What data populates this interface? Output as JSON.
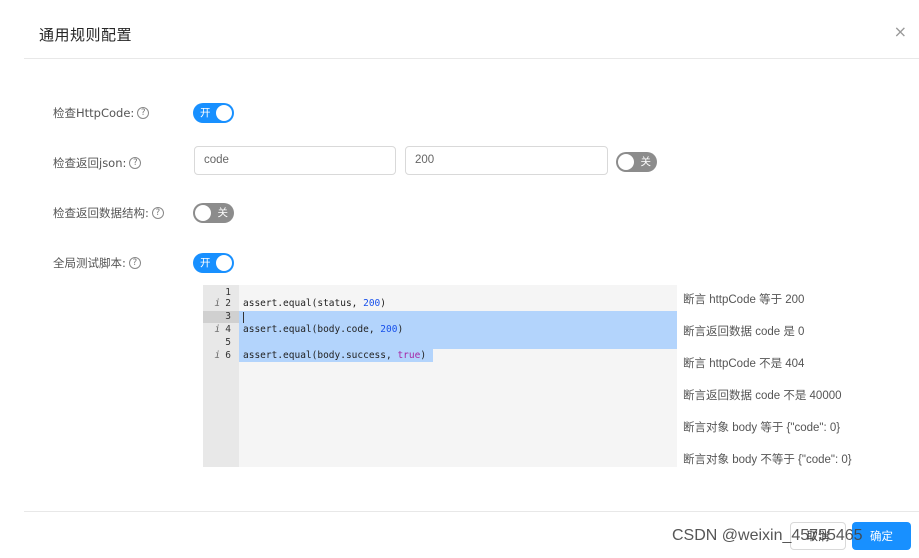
{
  "dialog": {
    "title": "通用规则配置",
    "close_icon": "×"
  },
  "form": {
    "http_code": {
      "label": "检查HttpCode:",
      "help_icon": "?",
      "switch_on": true,
      "switch_text": "开"
    },
    "return_json": {
      "label": "检查返回json:",
      "help_icon": "?",
      "key_value": "code",
      "value_value": "200",
      "switch_on": false,
      "switch_text": "关"
    },
    "data_structure": {
      "label": "检查返回数据结构:",
      "help_icon": "?",
      "switch_on": false,
      "switch_text": "关"
    },
    "global_script": {
      "label": "全局测试脚本:",
      "help_icon": "?",
      "switch_on": true,
      "switch_text": "开"
    }
  },
  "editor": {
    "lines": [
      {
        "number": "1",
        "info": "",
        "code": ""
      },
      {
        "number": "2",
        "info": "i",
        "code_prefix": "assert.equal(status, ",
        "code_num": "200",
        "code_suffix": ")"
      },
      {
        "number": "3",
        "info": "",
        "code": ""
      },
      {
        "number": "4",
        "info": "i",
        "code_prefix": "assert.equal(body.code, ",
        "code_num": "200",
        "code_suffix": ")"
      },
      {
        "number": "5",
        "info": "",
        "code": ""
      },
      {
        "number": "6",
        "info": "i",
        "code_prefix": "assert.equal(body.success, ",
        "code_kw": "true",
        "code_suffix": ")"
      }
    ]
  },
  "suggestions": [
    "断言 httpCode 等于 200",
    "断言返回数据 code 是 0",
    "断言 httpCode 不是 404",
    "断言返回数据 code 不是 40000",
    "断言对象 body 等于 {\"code\": 0}",
    "断言对象 body 不等于 {\"code\": 0}"
  ],
  "footer": {
    "cancel_label": "取消",
    "ok_label": "确定"
  },
  "watermark": "CSDN @weixin_45755465",
  "colors": {
    "primary": "#1890ff",
    "switch_off": "#8c8c8c",
    "selection": "#b3d4fc"
  }
}
